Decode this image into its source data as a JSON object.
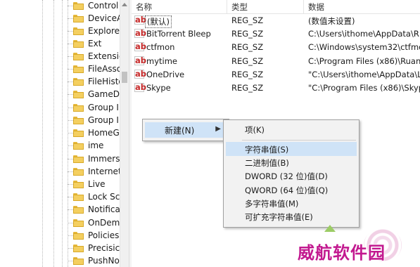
{
  "tree": {
    "items": [
      "Control",
      "DeviceA",
      "Explore",
      "Ext",
      "Extensic",
      "FileAsso",
      "FileHisto",
      "GameD",
      "Group I",
      "Group I",
      "HomeG",
      "ime",
      "Immers",
      "Internet",
      "Live",
      "Lock Sc",
      "Notifica",
      "OnDem",
      "Policies",
      "Precisic",
      "PushNo"
    ]
  },
  "columns": {
    "name": "名称",
    "type": "类型",
    "data": "数据"
  },
  "rows": [
    {
      "icon": "string-value-icon",
      "name": "(默认)",
      "type": "REG_SZ",
      "data": "(数值未设置)"
    },
    {
      "icon": "string-value-icon",
      "name": "BitTorrent Bleep",
      "type": "REG_SZ",
      "data": "C:\\Users\\ithome\\AppData\\R"
    },
    {
      "icon": "string-value-icon",
      "name": "ctfmon",
      "type": "REG_SZ",
      "data": "C:\\Windows\\system32\\ctfmo"
    },
    {
      "icon": "string-value-icon",
      "name": "mytime",
      "type": "REG_SZ",
      "data": "C:\\Program Files (x86)\\Ruan"
    },
    {
      "icon": "string-value-icon",
      "name": "OneDrive",
      "type": "REG_SZ",
      "data": "\"C:\\Users\\ithome\\AppData\\L"
    },
    {
      "icon": "string-value-icon",
      "name": "Skype",
      "type": "REG_SZ",
      "data": "\"C:\\Program Files (x86)\\Skyp"
    }
  ],
  "icon_glyph": "ab",
  "context_menu": {
    "new_label": "新建(N)",
    "submenu_arrow": "▶"
  },
  "submenu": {
    "items": [
      "项(K)",
      "字符串值(S)",
      "二进制值(B)",
      "DWORD (32 位)值(D)",
      "QWORD (64 位)值(Q)",
      "多字符串值(M)",
      "可扩充字符串值(E)"
    ],
    "highlighted": "字符串值(S)"
  },
  "watermark": {
    "text": "威航软件园"
  },
  "colors": {
    "highlight": "#cfe3f7",
    "menu_bg": "#f2f2f2",
    "icon_red": "#c62828",
    "watermark": "#c2188f",
    "folder": "#f4cf60"
  }
}
